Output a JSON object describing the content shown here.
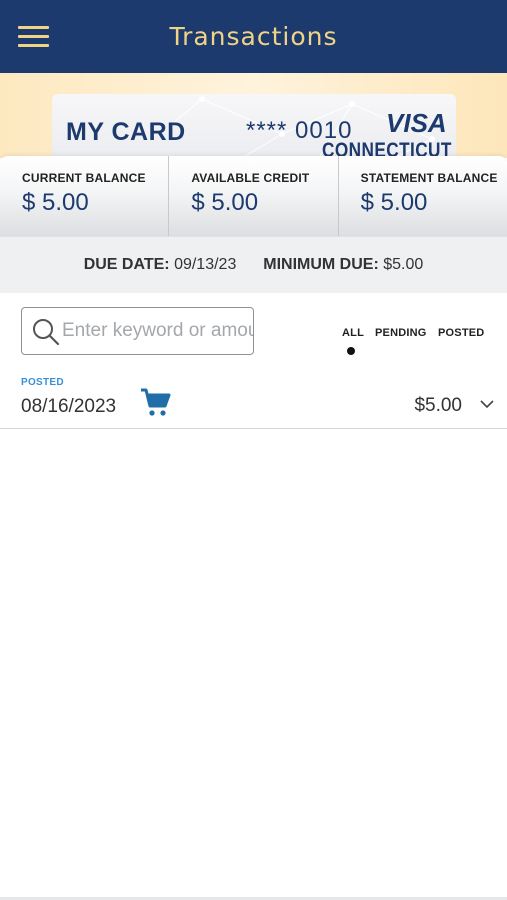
{
  "header": {
    "title": "Transactions",
    "menu_icon": "hamburger-menu-icon",
    "bg_color": "#1d3a6e",
    "title_color": "#f0d486"
  },
  "card": {
    "name": "MY CARD",
    "number_masked": "**** 0010",
    "brand": "VISA",
    "state": "CONNECTICUT"
  },
  "balances": [
    {
      "label": "CURRENT BALANCE",
      "value": "$ 5.00"
    },
    {
      "label": "AVAILABLE CREDIT",
      "value": "$ 5.00"
    },
    {
      "label": "STATEMENT BALANCE",
      "value": "$ 5.00"
    }
  ],
  "due": {
    "date_label": "DUE DATE:",
    "date_value": "09/13/23",
    "min_label": "MINIMUM DUE:",
    "min_value": "$5.00"
  },
  "search": {
    "placeholder": "Enter keyword or amount",
    "value": "",
    "icon": "search-icon"
  },
  "filters": {
    "options": [
      "ALL",
      "PENDING",
      "POSTED"
    ],
    "selected": "ALL"
  },
  "transactions": [
    {
      "status": "POSTED",
      "date": "08/16/2023",
      "category_icon": "shopping-cart-icon",
      "amount": "$5.00",
      "expand_icon": "chevron-down-icon"
    }
  ],
  "colors": {
    "accent_navy": "#1d3a6e",
    "gold": "#f0d486",
    "posted_blue": "#3a8fd8",
    "cart_blue": "#1f6ea8"
  }
}
